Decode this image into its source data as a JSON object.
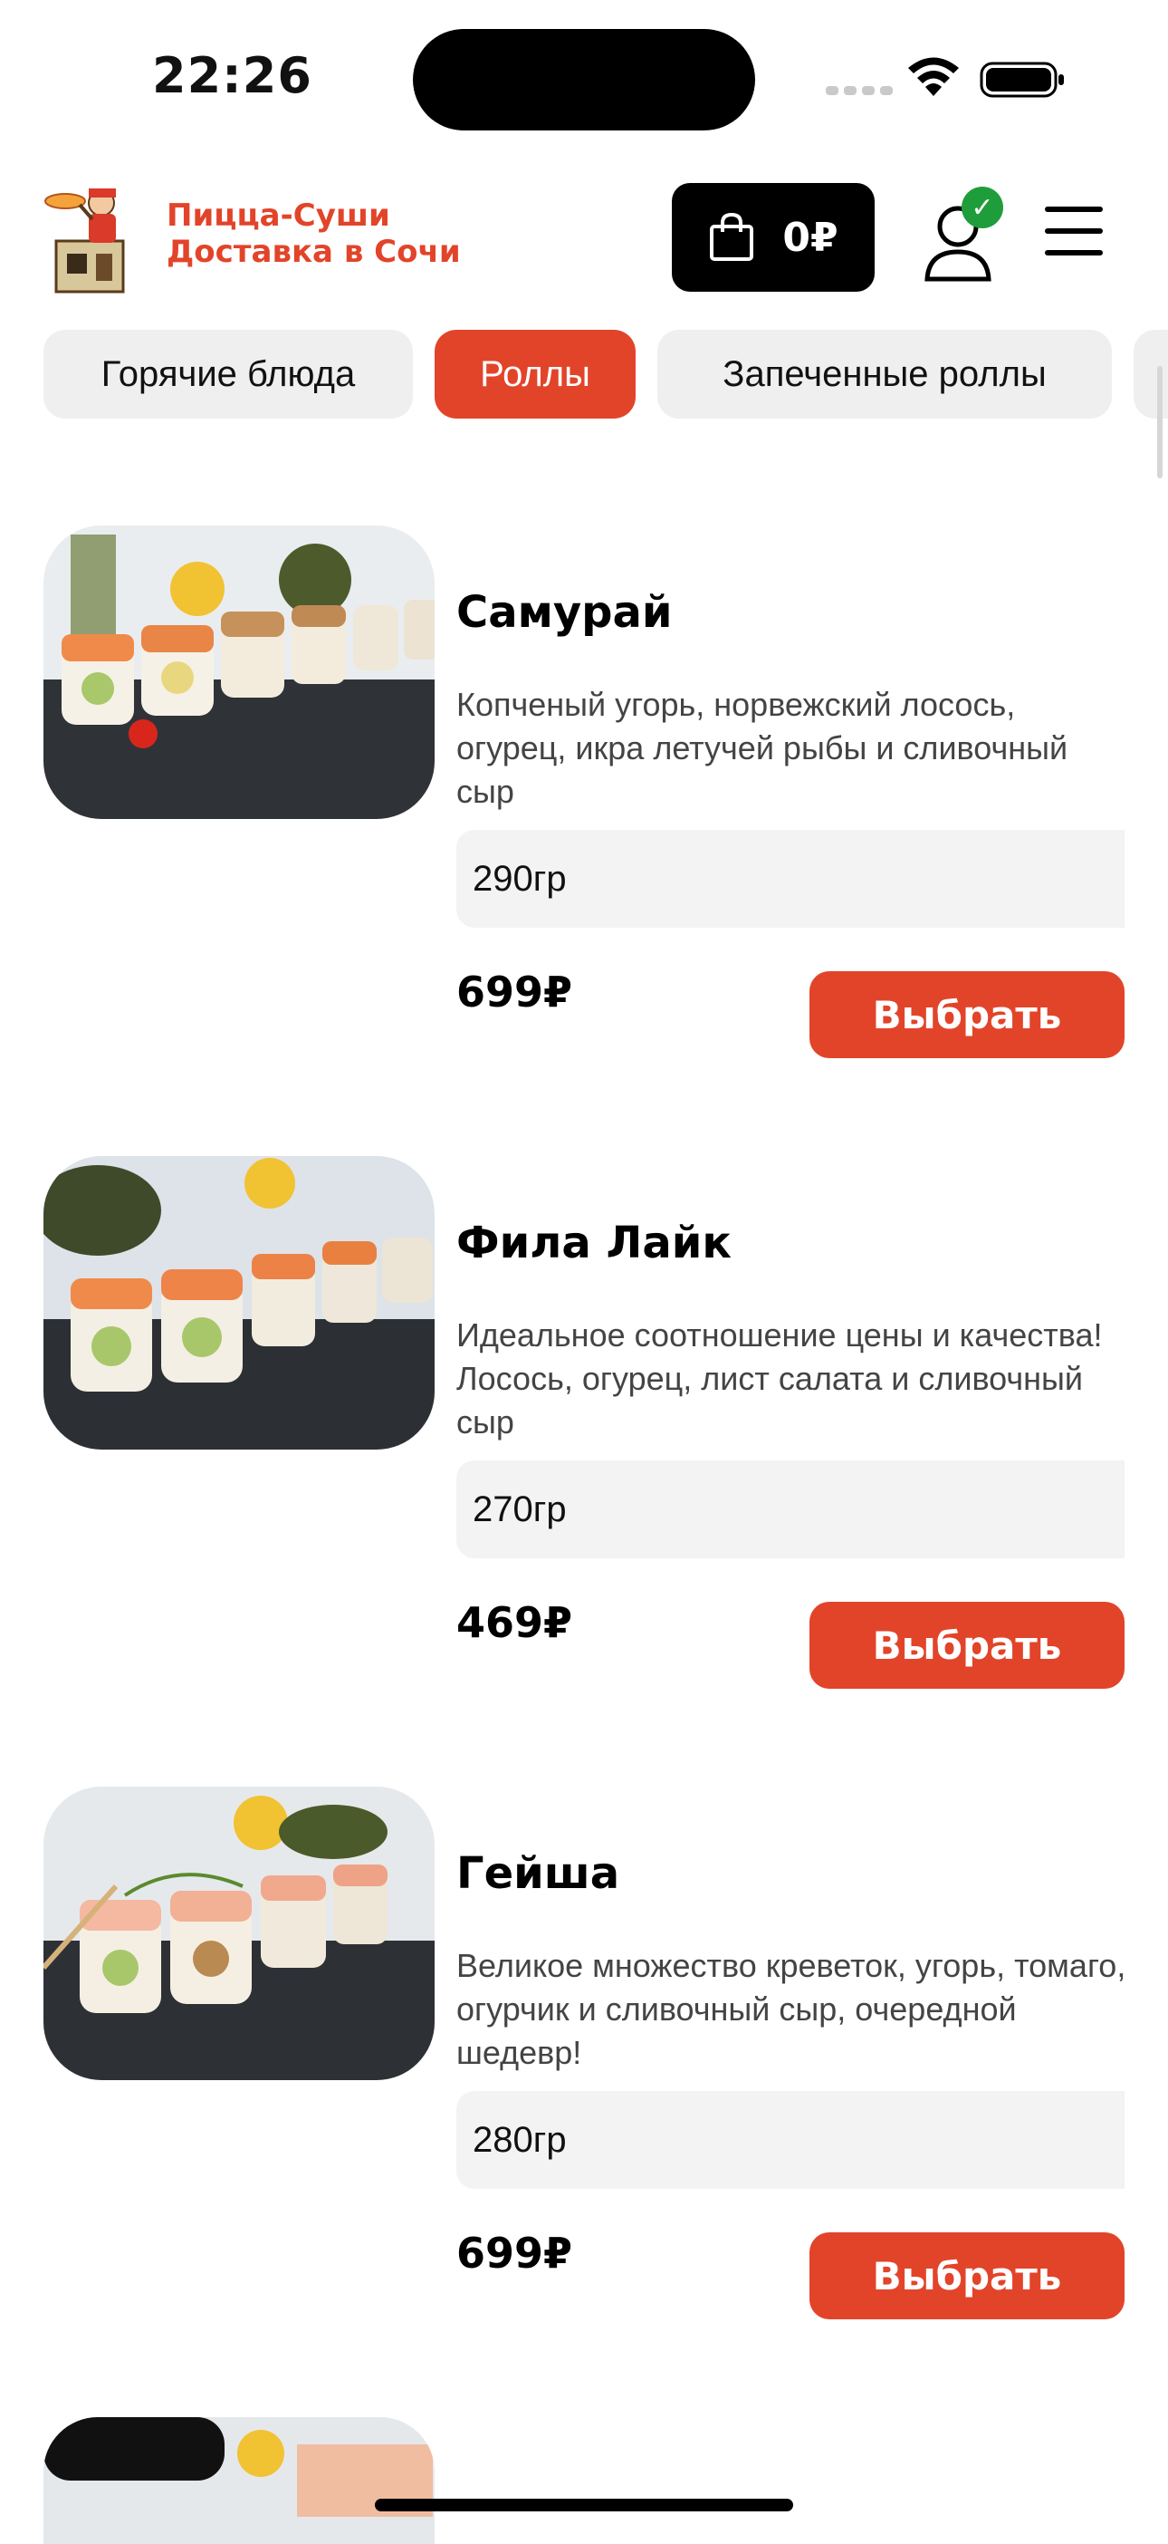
{
  "status_bar": {
    "time": "22:26"
  },
  "header": {
    "logo_line1": "Пицца-Суши",
    "logo_line2": "Доставка в Сочи",
    "cart_amount": "0₽",
    "user_check": "✓"
  },
  "tabs": [
    {
      "label": "Горячие блюда",
      "active": false
    },
    {
      "label": "Роллы",
      "active": true
    },
    {
      "label": "Запеченные роллы",
      "active": false
    }
  ],
  "products": [
    {
      "name": "Самурай",
      "description": "Копченый угорь, норвежский лосось, огурец, икра летучей рыбы и сливочный сыр",
      "weight": "290гр",
      "price": "699₽",
      "button": "Выбрать"
    },
    {
      "name": "Фила Лайк",
      "description": "Идеальное соотношение цены и качества! Лосось, огурец, лист салата и сливочный сыр",
      "weight": "270гр",
      "price": "469₽",
      "button": "Выбрать"
    },
    {
      "name": "Гейша",
      "description": "Великое множество креветок, угорь, томаго, огурчик и сливочный сыр, очередной шедевр!",
      "weight": "280гр",
      "price": "699₽",
      "button": "Выбрать"
    }
  ],
  "colors": {
    "accent": "#e2442a",
    "dark": "#000000",
    "muted_bg": "#efefef",
    "success": "#1f9d3a"
  }
}
